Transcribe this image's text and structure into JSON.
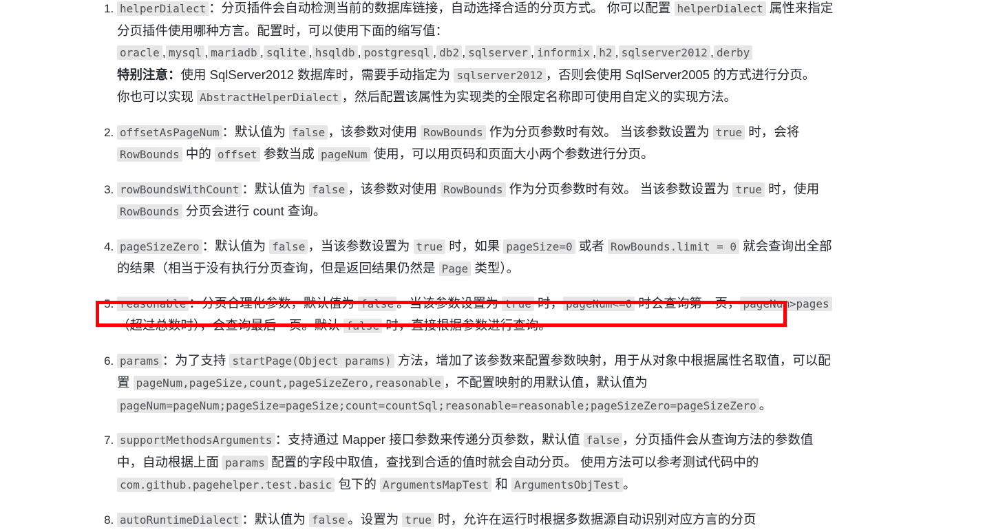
{
  "page": {
    "highlight_color": "#fb0007",
    "code_bg": "#e6e6e6",
    "text_color": "#24292e"
  },
  "items": [
    {
      "num": "1",
      "name": "helperDialect",
      "p1_a": "：分页插件会自动检测当前的数据库链接，自动选择合适的分页方式。 你可以配置 ",
      "p1_code": "helperDialect",
      "p1_b": " 属性来指定分页插件使用哪种方言。配置时，可以使用下面的缩写值：",
      "dialects": [
        "oracle",
        "mysql",
        "mariadb",
        "sqlite",
        "hsqldb",
        "postgresql",
        "db2",
        "sqlserver",
        "informix",
        "h2",
        "sqlserver2012",
        "derby"
      ],
      "note_label": "特别注意：",
      "note_a": "使用 SqlServer2012 数据库时，需要手动指定为 ",
      "note_code": "sqlserver2012",
      "note_b": "，否则会使用 SqlServer2005 的方式进行分页。",
      "impl_a": "你也可以实现 ",
      "impl_code": "AbstractHelperDialect",
      "impl_b": "，然后配置该属性为实现类的全限定名称即可使用自定义的实现方法。"
    },
    {
      "num": "2",
      "name": "offsetAsPageNum",
      "t1": "：默认值为 ",
      "c1": "false",
      "t2": "，该参数对使用 ",
      "c2": "RowBounds",
      "t3": " 作为分页参数时有效。 当该参数设置为 ",
      "c3": "true",
      "t4": " 时，会将 ",
      "c4": "RowBounds",
      "t5": " 中的 ",
      "c5": "offset",
      "t6": " 参数当成 ",
      "c6": "pageNum",
      "t7": " 使用，可以用页码和页面大小两个参数进行分页。"
    },
    {
      "num": "3",
      "name": "rowBoundsWithCount",
      "t1": "：默认值为 ",
      "c1": "false",
      "t2": "，该参数对使用 ",
      "c2": "RowBounds",
      "t3": " 作为分页参数时有效。 当该参数设置为 ",
      "c3": "true",
      "t4": " 时，使用 ",
      "c4": "RowBounds",
      "t5": " 分页会进行 count 查询。"
    },
    {
      "num": "4",
      "name": "pageSizeZero",
      "t1": "：默认值为 ",
      "c1": "false",
      "t2": "，当该参数设置为 ",
      "c2": "true",
      "t3": " 时，如果 ",
      "c3": "pageSize=0",
      "t4": " 或者 ",
      "c4": "RowBounds.limit = 0",
      "t5": " 就会查询出全部的结果（相当于没有执行分页查询，但是返回结果仍然是 ",
      "c5": "Page",
      "t6": " 类型）。"
    },
    {
      "num": "5",
      "name": "reasonable",
      "t1": "：分页合理化参数，默认值为 ",
      "c1": "false",
      "t2": "。当该参数设置为 ",
      "c2": "true",
      "t3": " 时，",
      "c3": "pageNum<=0",
      "t4": " 时会查询第一页，",
      "c4": "pageNum>pages",
      "t5": "（超过总数时），会查询最后一页。默认 ",
      "c5": "false",
      "t6": " 时，直接根据参数进行查询。",
      "highlighted": true
    },
    {
      "num": "6",
      "name": "params",
      "t1": "：为了支持 ",
      "c1": "startPage(Object params)",
      "t2": " 方法，增加了该参数来配置参数映射，用于从对象中根据属性名取值，可以配置 ",
      "c2": "pageNum,pageSize,count,pageSizeZero,reasonable",
      "t3": "，不配置映射的用默认值，默认值为 ",
      "c3": "pageNum=pageNum;pageSize=pageSize;count=countSql;reasonable=reasonable;pageSizeZero=pageSizeZero",
      "t4": "。"
    },
    {
      "num": "7",
      "name": "supportMethodsArguments",
      "t1": "：支持通过 Mapper 接口参数来传递分页参数，默认值 ",
      "c1": "false",
      "t2": "，分页插件会从查询方法的参数值中，自动根据上面 ",
      "c2": "params",
      "t3": " 配置的字段中取值，查找到合适的值时就会自动分页。 使用方法可以参考测试代码中的 ",
      "c3": "com.github.pagehelper.test.basic",
      "t4": " 包下的 ",
      "c4": "ArgumentsMapTest",
      "t5": " 和 ",
      "c5": "ArgumentsObjTest",
      "t6": "。"
    },
    {
      "num": "8",
      "name": "autoRuntimeDialect",
      "t1": "：默认值为 ",
      "c1": "false",
      "t2": "。设置为 ",
      "c2": "true",
      "t3": " 时，允许在运行时根据多数据源自动识别对应方言的分页"
    }
  ]
}
